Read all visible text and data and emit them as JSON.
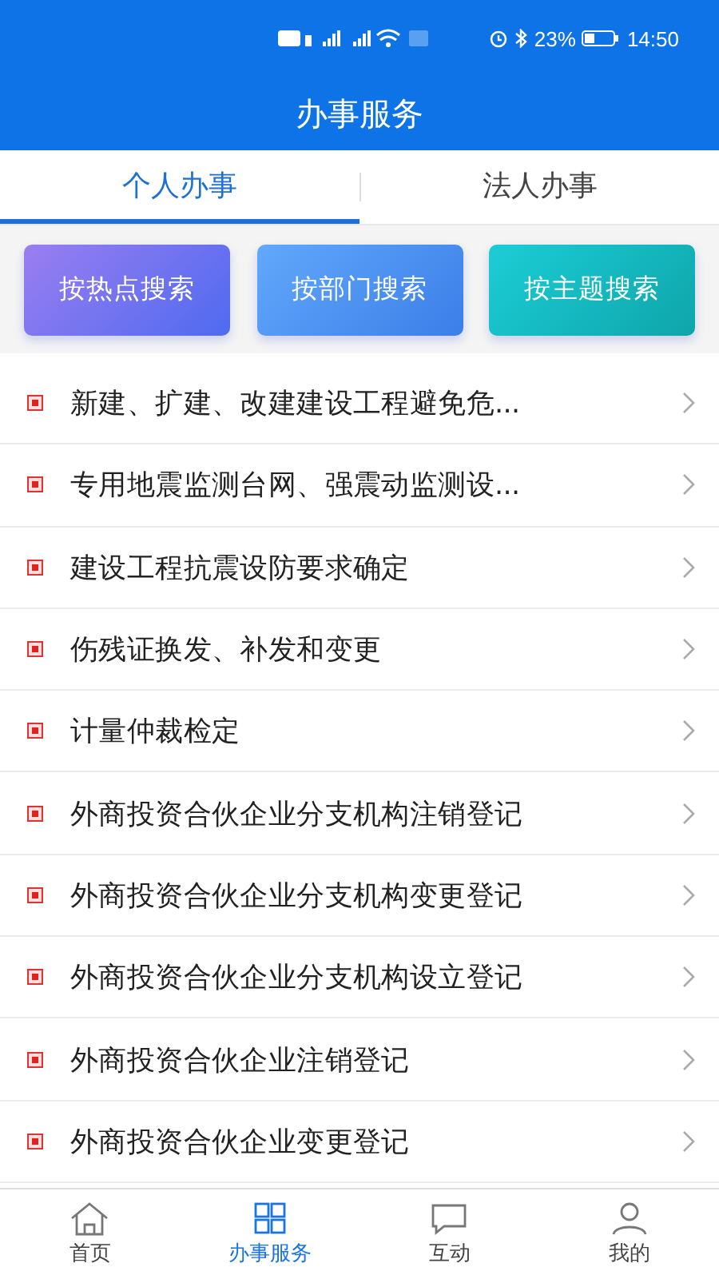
{
  "status_bar": {
    "battery": "23%",
    "time": "14:50"
  },
  "header": {
    "title": "办事服务"
  },
  "tabs": [
    {
      "label": "个人办事",
      "selected": true
    },
    {
      "label": "法人办事",
      "selected": false
    }
  ],
  "search_buttons": [
    {
      "label": "按热点搜索",
      "kind": "hot"
    },
    {
      "label": "按部门搜索",
      "kind": "dept"
    },
    {
      "label": "按主题搜索",
      "kind": "topic"
    }
  ],
  "items": [
    {
      "label": "新建、扩建、改建建设工程避免危..."
    },
    {
      "label": "专用地震监测台网、强震动监测设..."
    },
    {
      "label": "建设工程抗震设防要求确定"
    },
    {
      "label": "伤残证换发、补发和变更"
    },
    {
      "label": "计量仲裁检定"
    },
    {
      "label": "外商投资合伙企业分支机构注销登记"
    },
    {
      "label": "外商投资合伙企业分支机构变更登记"
    },
    {
      "label": "外商投资合伙企业分支机构设立登记"
    },
    {
      "label": "外商投资合伙企业注销登记"
    },
    {
      "label": "外商投资合伙企业变更登记"
    }
  ],
  "bottom_nav": [
    {
      "label": "首页",
      "kind": "home",
      "selected": false
    },
    {
      "label": "办事服务",
      "kind": "service",
      "selected": true
    },
    {
      "label": "互动",
      "kind": "chat",
      "selected": false
    },
    {
      "label": "我的",
      "kind": "user",
      "selected": false
    }
  ]
}
